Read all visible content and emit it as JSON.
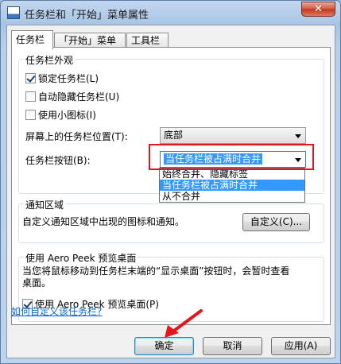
{
  "window": {
    "title": "任务栏和「开始」菜单属性",
    "close_glyph": "✕"
  },
  "tabs": [
    {
      "label": "任务栏"
    },
    {
      "label": "「开始」菜单"
    },
    {
      "label": "工具栏"
    }
  ],
  "appearance": {
    "group_label": "任务栏外观",
    "lock": {
      "label": "锁定任务栏(L)",
      "checked": true
    },
    "autohide": {
      "label": "自动隐藏任务栏(U)",
      "checked": false
    },
    "small_icons": {
      "label": "使用小图标(I)",
      "checked": false
    },
    "location": {
      "label": "屏幕上的任务栏位置(T):",
      "value": "底部"
    },
    "buttons": {
      "label": "任务栏按钮(B):",
      "value": "当任务栏被占满时合并",
      "options": [
        "始终合并、隐藏标签",
        "当任务栏被占满时合并",
        "从不合并"
      ],
      "selected_index": 1
    }
  },
  "notify": {
    "group_label": "通知区域",
    "text": "自定义通知区域中出现的图标和通知。",
    "button": "自定义(C)..."
  },
  "aero": {
    "group_label": "使用 Aero Peek 预览桌面",
    "description": "当您将鼠标移动到任务栏末端的“显示桌面”按钮时，会暂时查看桌面。",
    "check": {
      "label": "使用 Aero Peek 预览桌面(P)",
      "checked": true
    }
  },
  "link": "如何自定义该任务栏?",
  "footer": {
    "ok": "确定",
    "cancel": "取消",
    "apply": "应用(A)"
  },
  "annotations": {
    "highlight_color": "#e4151d"
  }
}
